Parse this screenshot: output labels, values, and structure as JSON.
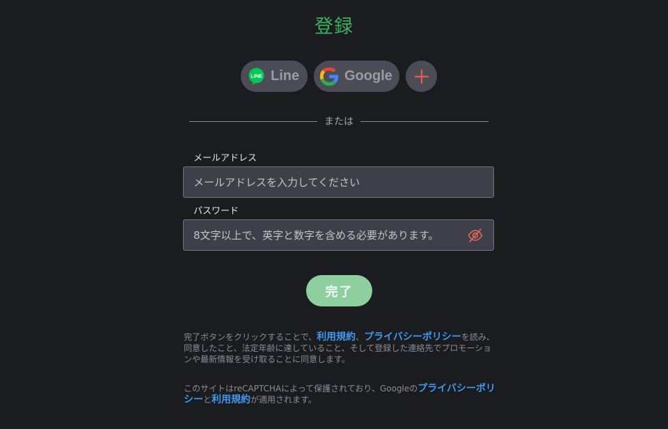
{
  "title": "登録",
  "social": {
    "line_label": "Line",
    "line_icon_text": "LINE",
    "google_label": "Google"
  },
  "divider_text": "または",
  "email": {
    "label": "メールアドレス",
    "placeholder": "メールアドレスを入力してください"
  },
  "password": {
    "label": "パスワード",
    "placeholder": "8文字以上で、英字と数字を含める必要があります。"
  },
  "submit_label": "完了",
  "terms_notice": {
    "prefix": "完了ボタンをクリックすることで、",
    "terms_link": "利用規約",
    "separator": "、",
    "privacy_link": "プライバシーポリシー",
    "suffix": "を読み、同意したこと、法定年齢に達していること、そして登録した連絡先でプロモーションや最新情報を受け取ることに同意します。"
  },
  "recaptcha_notice": {
    "prefix": "このサイトはreCAPTCHAによって保護されており、Googleの",
    "privacy_link": "プライバシーポリシー",
    "middle": "と",
    "terms_link": "利用規約",
    "suffix": "が適用されます。"
  },
  "icons": {
    "line": "line-icon",
    "google": "google-icon",
    "plus": "plus-icon",
    "eye_slash": "eye-slash-icon"
  },
  "colors": {
    "background": "#1b1c20",
    "title": "#3bb35b",
    "submit": "#8ecfa0",
    "link": "#3f98f0",
    "plus": "#e35b52",
    "line_green": "#06c755"
  }
}
